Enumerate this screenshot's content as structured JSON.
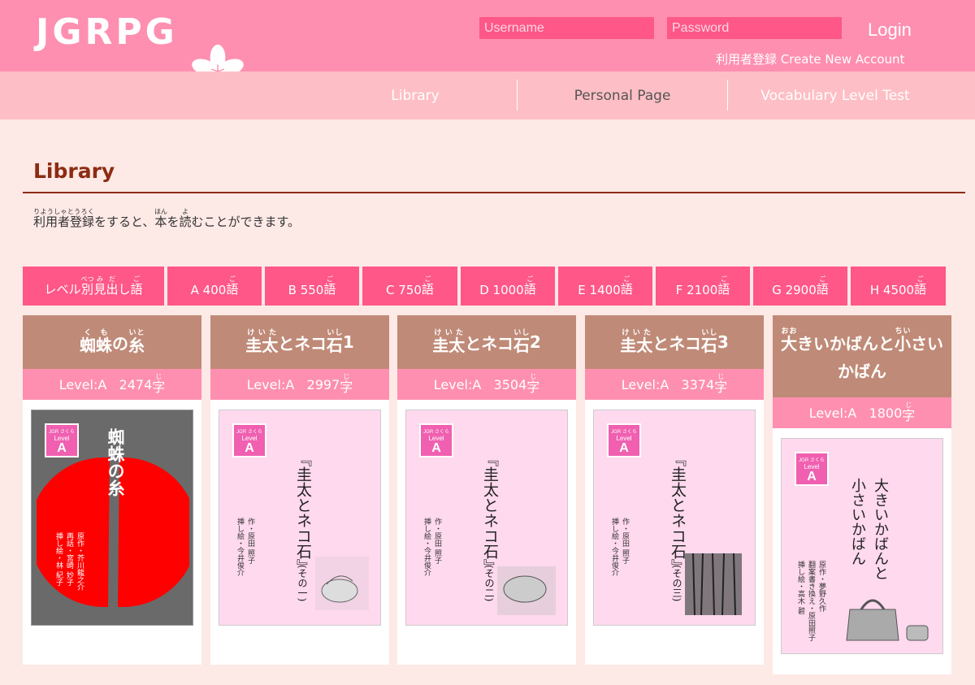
{
  "header": {
    "logo": "JGRPG",
    "username_placeholder": "Username",
    "password_placeholder": "Password",
    "login_label": "Login",
    "register_label": "利用者登録 Create New Account"
  },
  "nav": [
    {
      "label": "Library"
    },
    {
      "label": "Personal Page"
    },
    {
      "label": "Vocabulary Level Test"
    }
  ],
  "page": {
    "title": "Library",
    "intro_a": "利用者登録",
    "intro_a_rt": "りようしゃとうろく",
    "intro_b": "をすると、",
    "intro_c": "本",
    "intro_c_rt": "ほん",
    "intro_d": "を",
    "intro_e": "読",
    "intro_e_rt": "よ",
    "intro_f": "むことができます。"
  },
  "levels": [
    {
      "pre": "レベル",
      "base": "別",
      "rt": "べつ",
      "mid": "見",
      "rt2": "み",
      "mid2": "出",
      "rt3": "だ",
      "post": "し",
      "word": "語",
      "word_rt": "ご"
    },
    {
      "pre": "A 400",
      "word": "語",
      "word_rt": "ご"
    },
    {
      "pre": "B 550",
      "word": "語",
      "word_rt": "ご"
    },
    {
      "pre": "C 750",
      "word": "語",
      "word_rt": "ご"
    },
    {
      "pre": "D 1000",
      "word": "語",
      "word_rt": "ご"
    },
    {
      "pre": "E 1400",
      "word": "語",
      "word_rt": "ご"
    },
    {
      "pre": "F 2100",
      "word": "語",
      "word_rt": "ご"
    },
    {
      "pre": "G 2900",
      "word": "語",
      "word_rt": "ご"
    },
    {
      "pre": "H 4500",
      "word": "語",
      "word_rt": "ご"
    }
  ],
  "books": [
    {
      "title_parts": [
        {
          "k": "蜘蛛",
          "r": "くも"
        },
        {
          "k": "の"
        },
        {
          "k": "糸",
          "r": "いと"
        }
      ],
      "level": "Level:A",
      "chars": "2474",
      "char_unit": "字",
      "char_rt": "じ",
      "cover_title": "蜘蛛の糸",
      "cover_credits": [
        "原作・芥川龍之介",
        "再話・宮崎 妙子",
        "挿し絵・林 紀子"
      ],
      "cover_bg": "#6a6a6a",
      "accent": "#ff0000"
    },
    {
      "title_parts": [
        {
          "k": "圭太",
          "r": "けいた"
        },
        {
          "k": "とネコ"
        },
        {
          "k": "石",
          "r": "いし"
        },
        {
          "k": "1"
        }
      ],
      "level": "Level:A",
      "chars": "2997",
      "char_unit": "字",
      "char_rt": "じ",
      "cover_title": "『圭太とネコ石』",
      "cover_sub": "(その一)",
      "cover_credits": [
        "作・原田 照子",
        "挿し絵・今井俊介"
      ]
    },
    {
      "title_parts": [
        {
          "k": "圭太",
          "r": "けいた"
        },
        {
          "k": "とネコ"
        },
        {
          "k": "石",
          "r": "いし"
        },
        {
          "k": "2"
        }
      ],
      "level": "Level:A",
      "chars": "3504",
      "char_unit": "字",
      "char_rt": "じ",
      "cover_title": "『圭太とネコ石』",
      "cover_sub": "(その二)",
      "cover_credits": [
        "作・原田 照子",
        "挿し絵・今井俊介"
      ]
    },
    {
      "title_parts": [
        {
          "k": "圭太",
          "r": "けいた"
        },
        {
          "k": "とネコ"
        },
        {
          "k": "石",
          "r": "いし"
        },
        {
          "k": "3"
        }
      ],
      "level": "Level:A",
      "chars": "3374",
      "char_unit": "字",
      "char_rt": "じ",
      "cover_title": "『圭太とネコ石』",
      "cover_sub": "(その三)",
      "cover_credits": [
        "作・原田 照子",
        "挿し絵・今井俊介"
      ]
    },
    {
      "title_parts": [
        {
          "k": "大",
          "r": "おお"
        },
        {
          "k": "きいかばんと"
        },
        {
          "k": "小",
          "r": "ちい"
        },
        {
          "k": "さい"
        }
      ],
      "title_line2": "かばん",
      "level": "Level:A",
      "chars": "1800",
      "char_unit": "字",
      "char_rt": "じ",
      "cover_title": "大きいかばんと",
      "cover_title2": "小さいかばん",
      "cover_credits": [
        "原作・夢野久作",
        "翻案書き換え・原田照子",
        "挿し絵・高木 碧"
      ]
    }
  ],
  "badge": {
    "line1": "JGR さくら",
    "line2": "Level",
    "line3": "A"
  },
  "colors": {
    "header": "#fe8fb0",
    "nav": "#fdbfc5",
    "button": "#fe5788",
    "card_title": "#bf8a77",
    "title_text": "#8c2c12"
  }
}
